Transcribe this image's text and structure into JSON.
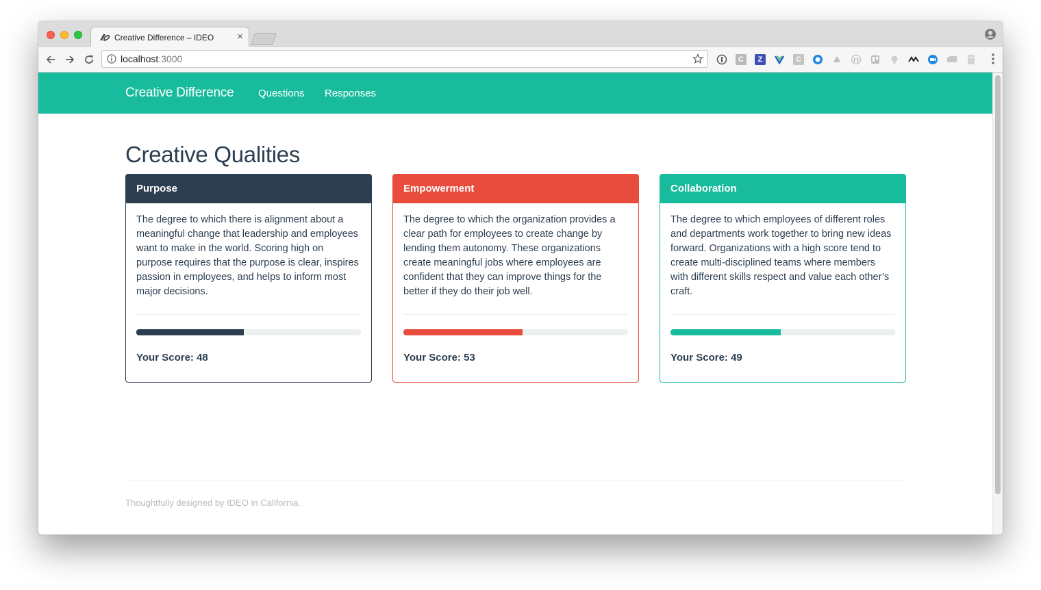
{
  "browser": {
    "tab_title": "Creative Difference – IDEO",
    "tab_close": "×",
    "url_host": "localhost",
    "url_port": ":3000"
  },
  "navbar": {
    "brand": "Creative Difference",
    "links": [
      "Questions",
      "Responses"
    ]
  },
  "page": {
    "title": "Creative Qualities"
  },
  "cards": [
    {
      "title": "Purpose",
      "color": "#2c3e50",
      "description": "The degree to which there is alignment about a meaningful change that leadership and employees want to make in the world. Scoring high on purpose requires that the purpose is clear, inspires passion in employees, and helps to inform most major decisions.",
      "score": 48,
      "score_label": "Your Score: 48"
    },
    {
      "title": "Empowerment",
      "color": "#e74c3c",
      "description": "The degree to which the organization provides a clear path for employees to create change by lending them autonomy. These organizations create meaningful jobs where employees are confident that they can improve things for the better if they do their job well.",
      "score": 53,
      "score_label": "Your Score: 53"
    },
    {
      "title": "Collaboration",
      "color": "#18bc9c",
      "description": "The degree to which employees of different roles and departments work together to bring new ideas forward. Organizations with a high score tend to create multi-disciplined teams where members with different skills respect and value each other’s craft.",
      "score": 49,
      "score_label": "Your Score: 49"
    }
  ],
  "footer": {
    "text": "Thoughtfully designed by IDEO in California."
  },
  "colors": {
    "navbar": "#18bc9c",
    "text_dark": "#2c3e50",
    "footer_text": "#b4bcc2"
  },
  "icons": [
    "back-icon",
    "forward-icon",
    "reload-icon",
    "info-icon",
    "star-icon",
    "profile-icon",
    "menu-icon"
  ]
}
